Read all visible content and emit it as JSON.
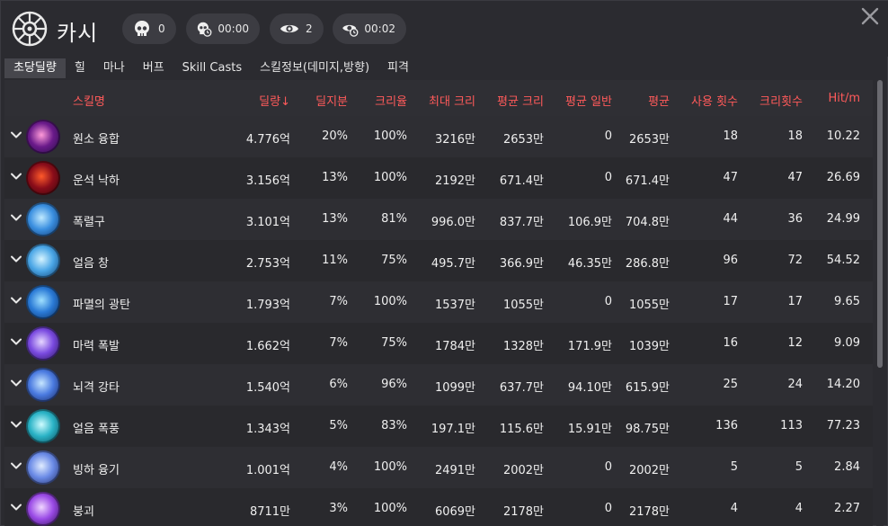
{
  "header": {
    "character_name": "카시",
    "class_icon": "class-emblem-icon",
    "stats": [
      {
        "icon": "skull-icon",
        "value": "0"
      },
      {
        "icon": "skull-timer-icon",
        "value": "00:00"
      },
      {
        "icon": "eye-icon",
        "value": "2"
      },
      {
        "icon": "eye-timer-icon",
        "value": "00:02"
      }
    ],
    "close_icon": "close-icon"
  },
  "tabs": [
    "초당딜량",
    "힐",
    "마나",
    "버프",
    "Skill Casts",
    "스킬정보(데미지,방향)",
    "피격"
  ],
  "active_tab": "초당딜량",
  "table": {
    "columns": [
      "스킬명",
      "딜량↓",
      "딜지분",
      "크리율",
      "최대 크리",
      "평균 크리",
      "평균 일반",
      "평균",
      "사용 횟수",
      "크리횟수",
      "Hit/m"
    ],
    "rows": [
      {
        "name": "원소 융합",
        "dmg": "4.776억",
        "share": "20%",
        "crit": "100%",
        "max_crit": "3216만",
        "avg_crit": "2653만",
        "avg_normal": "0",
        "avg": "2653만",
        "uses": "18",
        "crits": "18",
        "hitm": "10.22"
      },
      {
        "name": "운석 낙하",
        "dmg": "3.156억",
        "share": "13%",
        "crit": "100%",
        "max_crit": "2192만",
        "avg_crit": "671.4만",
        "avg_normal": "0",
        "avg": "671.4만",
        "uses": "47",
        "crits": "47",
        "hitm": "26.69"
      },
      {
        "name": "폭렬구",
        "dmg": "3.101억",
        "share": "13%",
        "crit": "81%",
        "max_crit": "996.0만",
        "avg_crit": "837.7만",
        "avg_normal": "106.9만",
        "avg": "704.8만",
        "uses": "44",
        "crits": "36",
        "hitm": "24.99"
      },
      {
        "name": "얼음 창",
        "dmg": "2.753억",
        "share": "11%",
        "crit": "75%",
        "max_crit": "495.7만",
        "avg_crit": "366.9만",
        "avg_normal": "46.35만",
        "avg": "286.8만",
        "uses": "96",
        "crits": "72",
        "hitm": "54.52"
      },
      {
        "name": "파멸의 광탄",
        "dmg": "1.793억",
        "share": "7%",
        "crit": "100%",
        "max_crit": "1537만",
        "avg_crit": "1055만",
        "avg_normal": "0",
        "avg": "1055만",
        "uses": "17",
        "crits": "17",
        "hitm": "9.65"
      },
      {
        "name": "마력 폭발",
        "dmg": "1.662억",
        "share": "7%",
        "crit": "75%",
        "max_crit": "1784만",
        "avg_crit": "1328만",
        "avg_normal": "171.9만",
        "avg": "1039만",
        "uses": "16",
        "crits": "12",
        "hitm": "9.09"
      },
      {
        "name": "뇌격 강타",
        "dmg": "1.540억",
        "share": "6%",
        "crit": "96%",
        "max_crit": "1099만",
        "avg_crit": "637.7만",
        "avg_normal": "94.10만",
        "avg": "615.9만",
        "uses": "25",
        "crits": "24",
        "hitm": "14.20"
      },
      {
        "name": "얼음 폭풍",
        "dmg": "1.343억",
        "share": "5%",
        "crit": "83%",
        "max_crit": "197.1만",
        "avg_crit": "115.6만",
        "avg_normal": "15.91만",
        "avg": "98.75만",
        "uses": "136",
        "crits": "113",
        "hitm": "77.23"
      },
      {
        "name": "빙하 융기",
        "dmg": "1.001억",
        "share": "4%",
        "crit": "100%",
        "max_crit": "2491만",
        "avg_crit": "2002만",
        "avg_normal": "0",
        "avg": "2002만",
        "uses": "5",
        "crits": "5",
        "hitm": "2.84"
      },
      {
        "name": "붕괴",
        "dmg": "8711만",
        "share": "3%",
        "crit": "100%",
        "max_crit": "6069만",
        "avg_crit": "2178만",
        "avg_normal": "0",
        "avg": "2178만",
        "uses": "4",
        "crits": "4",
        "hitm": "2.27"
      }
    ]
  },
  "colors": {
    "header_text": "#ff5a5a",
    "background": "#2b2b30",
    "row_alt": "#2e2e33",
    "pill": "#3c3c42"
  }
}
